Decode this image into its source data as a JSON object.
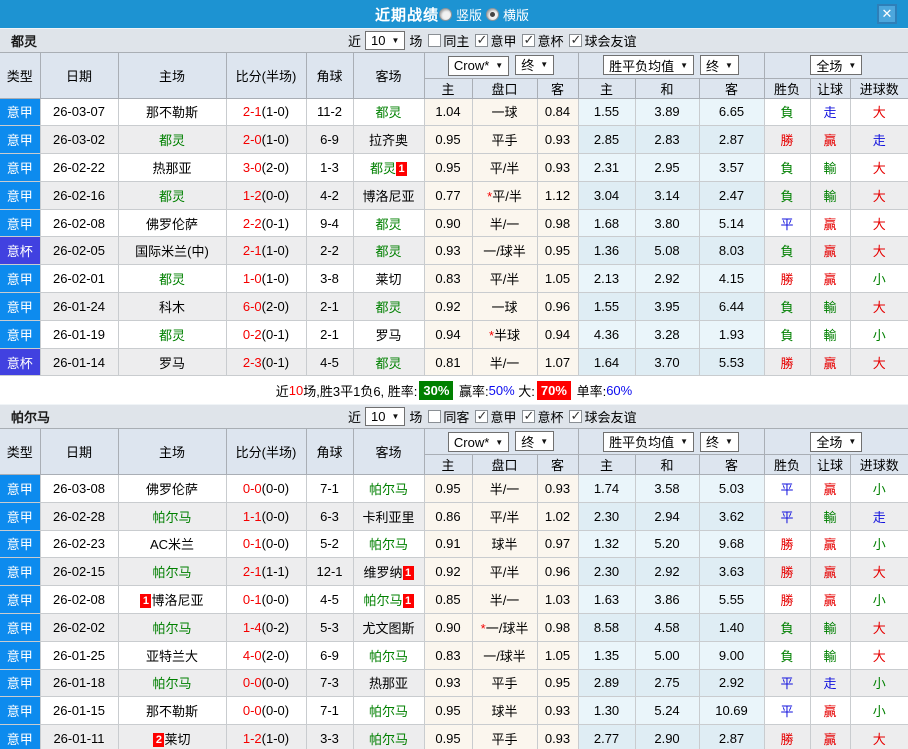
{
  "titlebar": {
    "title": "近期战绩",
    "radios": [
      {
        "label": "竖版",
        "checked": false
      },
      {
        "label": "横版",
        "checked": true
      }
    ],
    "close_label": "✕"
  },
  "league_colors": {
    "意甲": "#0d8bee",
    "意杯": "#4141e0"
  },
  "result_colors": {
    "勝": "#e60000",
    "贏": "#e60000",
    "大": "#e60000",
    "負": "#008000",
    "輸": "#008000",
    "小": "#008000",
    "平": "#1111dd",
    "走": "#1111dd"
  },
  "head": {
    "col_type": "类型",
    "col_date": "日期",
    "col_home": "主场",
    "col_score": "比分(半场)",
    "col_corner": "角球",
    "col_away": "客场",
    "odds_select": "Crow*",
    "odds_state_select": "终",
    "avg_select": "胜平负均值",
    "avg_state_select": "终",
    "scope_select": "全场",
    "sub_odds_home": "主",
    "sub_odds_handicap": "盘口",
    "sub_odds_away": "客",
    "sub_avg_home": "主",
    "sub_avg_draw": "和",
    "sub_avg_away": "客",
    "sub_res_wdl": "胜负",
    "sub_res_handicap": "让球",
    "sub_res_goals": "进球数"
  },
  "sections": [
    {
      "team": "都灵",
      "filter": {
        "prefix": "近",
        "count": "10",
        "suffix": "场",
        "checkboxes": [
          {
            "label": "同主",
            "checked": false
          },
          {
            "label": "意甲",
            "checked": true
          },
          {
            "label": "意杯",
            "checked": true
          },
          {
            "label": "球会友谊",
            "checked": true
          }
        ]
      },
      "rows": [
        {
          "league": "意甲",
          "date": "26-03-07",
          "home": {
            "name": "那不勒斯"
          },
          "score": "2-1",
          "half": "(1-0)",
          "corners": "11-2",
          "away": {
            "name": "都灵",
            "focus": true
          },
          "odds_home": "1.04",
          "handicap": "一球",
          "star": false,
          "odds_away": "0.84",
          "avg_home": "1.55",
          "avg_draw": "3.89",
          "avg_away": "6.65",
          "res_wdl": "負",
          "res_handicap": "走",
          "res_goals": "大"
        },
        {
          "league": "意甲",
          "date": "26-03-02",
          "home": {
            "name": "都灵",
            "focus": true
          },
          "score": "2-0",
          "half": "(1-0)",
          "corners": "6-9",
          "away": {
            "name": "拉齐奥"
          },
          "odds_home": "0.95",
          "handicap": "平手",
          "star": false,
          "odds_away": "0.93",
          "avg_home": "2.85",
          "avg_draw": "2.83",
          "avg_away": "2.87",
          "res_wdl": "勝",
          "res_handicap": "贏",
          "res_goals": "走"
        },
        {
          "league": "意甲",
          "date": "26-02-22",
          "home": {
            "name": "热那亚"
          },
          "score": "3-0",
          "half": "(2-0)",
          "corners": "1-3",
          "away": {
            "name": "都灵",
            "focus": true,
            "badge_after": "1"
          },
          "odds_home": "0.95",
          "handicap": "平/半",
          "star": false,
          "odds_away": "0.93",
          "avg_home": "2.31",
          "avg_draw": "2.95",
          "avg_away": "3.57",
          "res_wdl": "負",
          "res_handicap": "輸",
          "res_goals": "大"
        },
        {
          "league": "意甲",
          "date": "26-02-16",
          "home": {
            "name": "都灵",
            "focus": true
          },
          "score": "1-2",
          "half": "(0-0)",
          "corners": "4-2",
          "away": {
            "name": "博洛尼亚"
          },
          "odds_home": "0.77",
          "handicap": "平/半",
          "star": true,
          "odds_away": "1.12",
          "avg_home": "3.04",
          "avg_draw": "3.14",
          "avg_away": "2.47",
          "res_wdl": "負",
          "res_handicap": "輸",
          "res_goals": "大"
        },
        {
          "league": "意甲",
          "date": "26-02-08",
          "home": {
            "name": "佛罗伦萨"
          },
          "score": "2-2",
          "half": "(0-1)",
          "corners": "9-4",
          "away": {
            "name": "都灵",
            "focus": true
          },
          "odds_home": "0.90",
          "handicap": "半/一",
          "star": false,
          "odds_away": "0.98",
          "avg_home": "1.68",
          "avg_draw": "3.80",
          "avg_away": "5.14",
          "res_wdl": "平",
          "res_handicap": "贏",
          "res_goals": "大"
        },
        {
          "league": "意杯",
          "date": "26-02-05",
          "home": {
            "name": "国际米兰(中)"
          },
          "score": "2-1",
          "half": "(1-0)",
          "corners": "2-2",
          "away": {
            "name": "都灵",
            "focus": true
          },
          "odds_home": "0.93",
          "handicap": "一/球半",
          "star": false,
          "odds_away": "0.95",
          "avg_home": "1.36",
          "avg_draw": "5.08",
          "avg_away": "8.03",
          "res_wdl": "負",
          "res_handicap": "贏",
          "res_goals": "大"
        },
        {
          "league": "意甲",
          "date": "26-02-01",
          "home": {
            "name": "都灵",
            "focus": true
          },
          "score": "1-0",
          "half": "(1-0)",
          "corners": "3-8",
          "away": {
            "name": "莱切"
          },
          "odds_home": "0.83",
          "handicap": "平/半",
          "star": false,
          "odds_away": "1.05",
          "avg_home": "2.13",
          "avg_draw": "2.92",
          "avg_away": "4.15",
          "res_wdl": "勝",
          "res_handicap": "贏",
          "res_goals": "小"
        },
        {
          "league": "意甲",
          "date": "26-01-24",
          "home": {
            "name": "科木"
          },
          "score": "6-0",
          "half": "(2-0)",
          "corners": "2-1",
          "away": {
            "name": "都灵",
            "focus": true
          },
          "odds_home": "0.92",
          "handicap": "一球",
          "star": false,
          "odds_away": "0.96",
          "avg_home": "1.55",
          "avg_draw": "3.95",
          "avg_away": "6.44",
          "res_wdl": "負",
          "res_handicap": "輸",
          "res_goals": "大"
        },
        {
          "league": "意甲",
          "date": "26-01-19",
          "home": {
            "name": "都灵",
            "focus": true
          },
          "score": "0-2",
          "half": "(0-1)",
          "corners": "2-1",
          "away": {
            "name": "罗马"
          },
          "odds_home": "0.94",
          "handicap": "半球",
          "star": true,
          "odds_away": "0.94",
          "avg_home": "4.36",
          "avg_draw": "3.28",
          "avg_away": "1.93",
          "res_wdl": "負",
          "res_handicap": "輸",
          "res_goals": "小"
        },
        {
          "league": "意杯",
          "date": "26-01-14",
          "home": {
            "name": "罗马"
          },
          "score": "2-3",
          "half": "(0-1)",
          "corners": "4-5",
          "away": {
            "name": "都灵",
            "focus": true
          },
          "odds_home": "0.81",
          "handicap": "半/一",
          "star": false,
          "odds_away": "1.07",
          "avg_home": "1.64",
          "avg_draw": "3.70",
          "avg_away": "5.53",
          "res_wdl": "勝",
          "res_handicap": "贏",
          "res_goals": "大"
        }
      ],
      "summary": [
        {
          "text": "近",
          "kind": "plain"
        },
        {
          "text": "10",
          "kind": "red-text"
        },
        {
          "text": "场,胜3平1负6, 胜率:",
          "kind": "plain"
        },
        {
          "text": "30%",
          "kind": "green-box"
        },
        {
          "text": " 赢率:",
          "kind": "plain"
        },
        {
          "text": "50%",
          "kind": "blue-text"
        },
        {
          "text": " 大:",
          "kind": "plain"
        },
        {
          "text": "70%",
          "kind": "red-box"
        },
        {
          "text": " 单率:",
          "kind": "plain"
        },
        {
          "text": "60%",
          "kind": "blue-text"
        }
      ]
    },
    {
      "team": "帕尔马",
      "filter": {
        "prefix": "近",
        "count": "10",
        "suffix": "场",
        "checkboxes": [
          {
            "label": "同客",
            "checked": false
          },
          {
            "label": "意甲",
            "checked": true
          },
          {
            "label": "意杯",
            "checked": true
          },
          {
            "label": "球会友谊",
            "checked": true
          }
        ]
      },
      "rows": [
        {
          "league": "意甲",
          "date": "26-03-08",
          "home": {
            "name": "佛罗伦萨"
          },
          "score": "0-0",
          "half": "(0-0)",
          "corners": "7-1",
          "away": {
            "name": "帕尔马",
            "focus": true
          },
          "odds_home": "0.95",
          "handicap": "半/一",
          "star": false,
          "odds_away": "0.93",
          "avg_home": "1.74",
          "avg_draw": "3.58",
          "avg_away": "5.03",
          "res_wdl": "平",
          "res_handicap": "贏",
          "res_goals": "小"
        },
        {
          "league": "意甲",
          "date": "26-02-28",
          "home": {
            "name": "帕尔马",
            "focus": true
          },
          "score": "1-1",
          "half": "(0-0)",
          "corners": "6-3",
          "away": {
            "name": "卡利亚里"
          },
          "odds_home": "0.86",
          "handicap": "平/半",
          "star": false,
          "odds_away": "1.02",
          "avg_home": "2.30",
          "avg_draw": "2.94",
          "avg_away": "3.62",
          "res_wdl": "平",
          "res_handicap": "輸",
          "res_goals": "走"
        },
        {
          "league": "意甲",
          "date": "26-02-23",
          "home": {
            "name": "AC米兰"
          },
          "score": "0-1",
          "half": "(0-0)",
          "corners": "5-2",
          "away": {
            "name": "帕尔马",
            "focus": true
          },
          "odds_home": "0.91",
          "handicap": "球半",
          "star": false,
          "odds_away": "0.97",
          "avg_home": "1.32",
          "avg_draw": "5.20",
          "avg_away": "9.68",
          "res_wdl": "勝",
          "res_handicap": "贏",
          "res_goals": "小"
        },
        {
          "league": "意甲",
          "date": "26-02-15",
          "home": {
            "name": "帕尔马",
            "focus": true
          },
          "score": "2-1",
          "half": "(1-1)",
          "corners": "12-1",
          "away": {
            "name": "维罗纳",
            "badge_after": "1"
          },
          "odds_home": "0.92",
          "handicap": "平/半",
          "star": false,
          "odds_away": "0.96",
          "avg_home": "2.30",
          "avg_draw": "2.92",
          "avg_away": "3.63",
          "res_wdl": "勝",
          "res_handicap": "贏",
          "res_goals": "大"
        },
        {
          "league": "意甲",
          "date": "26-02-08",
          "home": {
            "name": "博洛尼亚",
            "badge_before": "1"
          },
          "score": "0-1",
          "half": "(0-0)",
          "corners": "4-5",
          "away": {
            "name": "帕尔马",
            "focus": true,
            "badge_after": "1"
          },
          "odds_home": "0.85",
          "handicap": "半/一",
          "star": false,
          "odds_away": "1.03",
          "avg_home": "1.63",
          "avg_draw": "3.86",
          "avg_away": "5.55",
          "res_wdl": "勝",
          "res_handicap": "贏",
          "res_goals": "小"
        },
        {
          "league": "意甲",
          "date": "26-02-02",
          "home": {
            "name": "帕尔马",
            "focus": true
          },
          "score": "1-4",
          "half": "(0-2)",
          "corners": "5-3",
          "away": {
            "name": "尤文图斯"
          },
          "odds_home": "0.90",
          "handicap": "一/球半",
          "star": true,
          "odds_away": "0.98",
          "avg_home": "8.58",
          "avg_draw": "4.58",
          "avg_away": "1.40",
          "res_wdl": "負",
          "res_handicap": "輸",
          "res_goals": "大"
        },
        {
          "league": "意甲",
          "date": "26-01-25",
          "home": {
            "name": "亚特兰大"
          },
          "score": "4-0",
          "half": "(2-0)",
          "corners": "6-9",
          "away": {
            "name": "帕尔马",
            "focus": true
          },
          "odds_home": "0.83",
          "handicap": "一/球半",
          "star": false,
          "odds_away": "1.05",
          "avg_home": "1.35",
          "avg_draw": "5.00",
          "avg_away": "9.00",
          "res_wdl": "負",
          "res_handicap": "輸",
          "res_goals": "大"
        },
        {
          "league": "意甲",
          "date": "26-01-18",
          "home": {
            "name": "帕尔马",
            "focus": true
          },
          "score": "0-0",
          "half": "(0-0)",
          "corners": "7-3",
          "away": {
            "name": "热那亚"
          },
          "odds_home": "0.93",
          "handicap": "平手",
          "star": false,
          "odds_away": "0.95",
          "avg_home": "2.89",
          "avg_draw": "2.75",
          "avg_away": "2.92",
          "res_wdl": "平",
          "res_handicap": "走",
          "res_goals": "小"
        },
        {
          "league": "意甲",
          "date": "26-01-15",
          "home": {
            "name": "那不勒斯"
          },
          "score": "0-0",
          "half": "(0-0)",
          "corners": "7-1",
          "away": {
            "name": "帕尔马",
            "focus": true
          },
          "odds_home": "0.95",
          "handicap": "球半",
          "star": false,
          "odds_away": "0.93",
          "avg_home": "1.30",
          "avg_draw": "5.24",
          "avg_away": "10.69",
          "res_wdl": "平",
          "res_handicap": "贏",
          "res_goals": "小"
        },
        {
          "league": "意甲",
          "date": "26-01-11",
          "home": {
            "name": "莱切",
            "badge_before": "2"
          },
          "score": "1-2",
          "half": "(1-0)",
          "corners": "3-3",
          "away": {
            "name": "帕尔马",
            "focus": true
          },
          "odds_home": "0.95",
          "handicap": "平手",
          "star": false,
          "odds_away": "0.93",
          "avg_home": "2.77",
          "avg_draw": "2.90",
          "avg_away": "2.87",
          "res_wdl": "勝",
          "res_handicap": "贏",
          "res_goals": "大"
        }
      ]
    }
  ]
}
